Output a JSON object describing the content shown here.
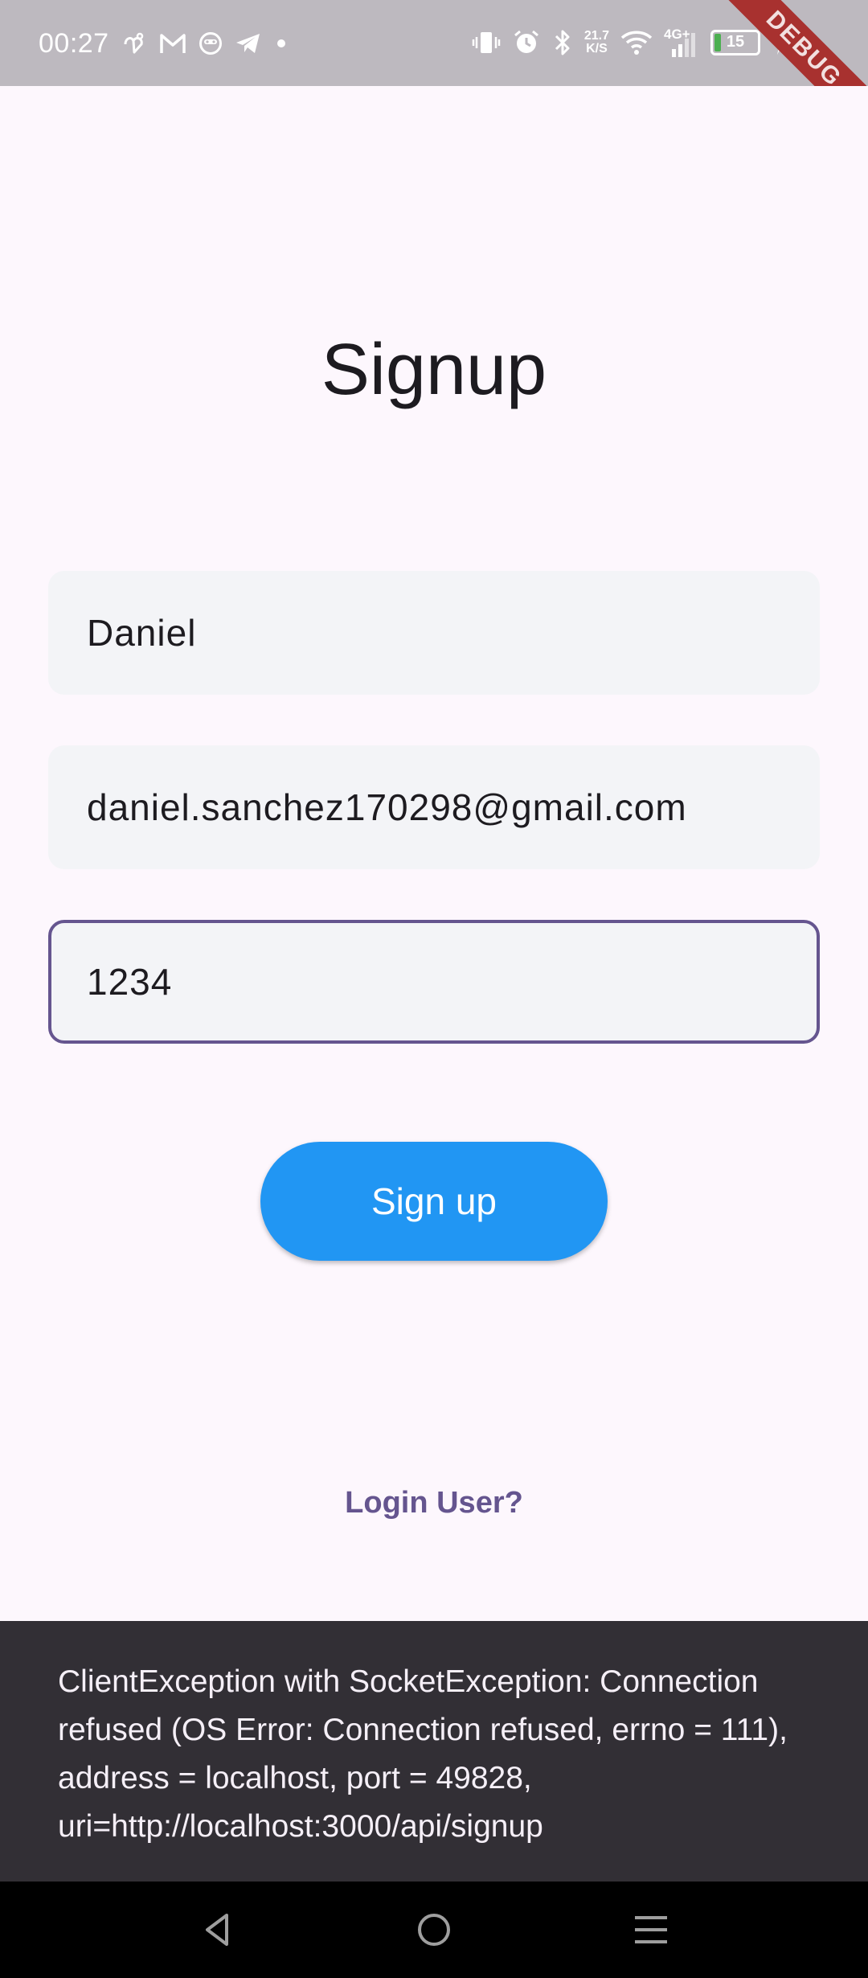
{
  "status_bar": {
    "time": "00:27",
    "net_speed_value": "21.7",
    "net_speed_unit": "K/S",
    "network_type": "4G+",
    "battery_level": "15",
    "debug_banner": "DEBUG",
    "left_icons": [
      "heart-hands-icon",
      "gmail-icon",
      "smiley-icon",
      "telegram-icon",
      "dot-icon"
    ],
    "right_icons": [
      "vibrate-icon",
      "alarm-icon",
      "bluetooth-icon",
      "net-speed",
      "wifi-icon",
      "signal-icon",
      "battery-icon",
      "charging-icon"
    ]
  },
  "signup": {
    "title": "Signup",
    "name_value": "Daniel",
    "email_value": "daniel.sanchez170298@gmail.com",
    "password_value": "1234",
    "button_label": "Sign up",
    "login_link": "Login User?"
  },
  "snackbar": {
    "message": "ClientException with SocketException: Connection refused (OS Error: Connection refused, errno = 111), address = localhost, port = 49828, uri=http://localhost:3000/api/signup"
  },
  "navigation": {
    "icons": [
      "back-triangle-icon",
      "home-circle-icon",
      "menu-lines-icon"
    ]
  },
  "colors": {
    "status_bar": "#bdb9bf",
    "background": "#fdf7fd",
    "field_background": "#f3f4f7",
    "focused_border": "#65558f",
    "button": "#2196f3",
    "link": "#65558f",
    "snackbar": "#322f35",
    "debug_banner": "#a8312f",
    "battery_fill": "#4caf50"
  }
}
